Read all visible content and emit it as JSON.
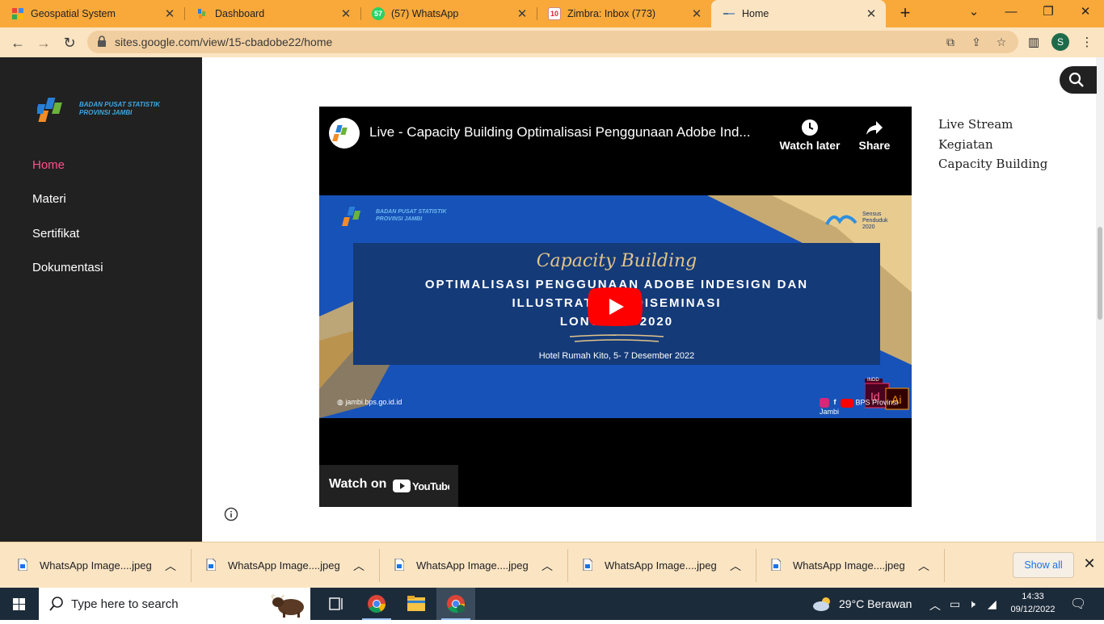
{
  "browser": {
    "tabs": [
      {
        "title": "Geospatial System",
        "icon": "grid-favicon-icon",
        "active": false
      },
      {
        "title": "Dashboard",
        "icon": "bps-favicon-icon",
        "active": false
      },
      {
        "title": "(57) WhatsApp",
        "icon": "whatsapp-favicon-icon",
        "badge": "57",
        "active": false
      },
      {
        "title": "Zimbra: Inbox (773)",
        "icon": "zimbra-favicon-icon",
        "badge": "10",
        "active": false
      },
      {
        "title": "Home",
        "icon": "sites-favicon-icon",
        "active": true
      }
    ],
    "url": "sites.google.com/view/15-cbadobe22/home",
    "profile_initial": "S",
    "accent_color": "#f9a93a"
  },
  "site": {
    "logo": {
      "line1": "BADAN PUSAT STATISTIK",
      "line2": "PROVINSI JAMBI"
    },
    "nav": [
      {
        "label": "Home",
        "active": true
      },
      {
        "label": "Materi",
        "active": false
      },
      {
        "label": "Sertifikat",
        "active": false
      },
      {
        "label": "Dokumentasi",
        "active": false
      }
    ],
    "right_links": [
      "Live Stream",
      "Kegiatan",
      "Capacity Building"
    ],
    "active_color": "#ff4f8b"
  },
  "video": {
    "title": "Live - Capacity Building Optimalisasi Penggunaan Adobe Ind...",
    "watch_later": "Watch later",
    "share": "Share",
    "watch_on": "Watch on",
    "youtube": "YouTube",
    "thumbnail": {
      "logo_line1": "BADAN PUSAT STATISTIK",
      "logo_line2": "PROVINSI JAMBI",
      "sensus_line1": "Sensus",
      "sensus_line2": "Penduduk",
      "sensus_line3": "2020",
      "script": "Capacity Building",
      "line1": "OPTIMALISASI PENGGUNAAN ADOBE INDESIGN DAN",
      "line2": "ILLUSTRATOR     K DISEMINASI",
      "line3": "LONG F       SP2020",
      "venue": "Hotel Rumah Kito, 5- 7 Desember 2022",
      "website": "jambi.bps.go.id.id",
      "channel": "BPS Provinsi Jambi",
      "adobe_id": "Id",
      "adobe_ai": "Ai",
      "indd": "INDD"
    }
  },
  "downloads": {
    "items": [
      "WhatsApp Image....jpeg",
      "WhatsApp Image....jpeg",
      "WhatsApp Image....jpeg",
      "WhatsApp Image....jpeg",
      "WhatsApp Image....jpeg"
    ],
    "show_all": "Show all"
  },
  "taskbar": {
    "search_placeholder": "Type here to search",
    "weather": "29°C  Berawan",
    "time": "14:33",
    "date": "09/12/2022"
  }
}
